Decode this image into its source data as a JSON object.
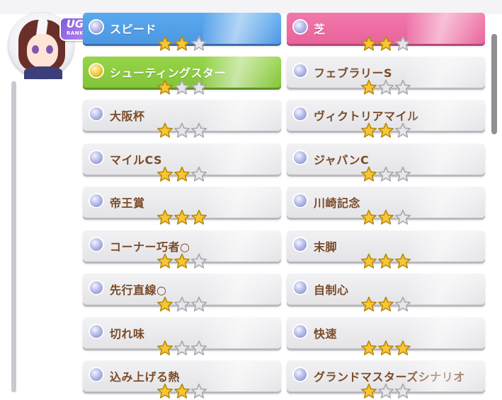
{
  "profile": {
    "rank_letters": "UG",
    "rank_word": "RANK"
  },
  "colors": {
    "star_filled": "#f7c632",
    "star_empty": "#e6e6ea",
    "label_text": "#7a4b28",
    "speed_card": "#4c97e3",
    "turf_card": "#e9639b",
    "unique_skill_card": "#82c537"
  },
  "skills": [
    {
      "label": "スピード",
      "stars": 2,
      "kind": "blue",
      "gem": "normal-gem-icon"
    },
    {
      "label": "芝",
      "stars": 2,
      "kind": "pink",
      "gem": "normal-gem-icon"
    },
    {
      "label": "シューティングスター",
      "stars": 1,
      "kind": "green",
      "gem": "gold-gem-icon"
    },
    {
      "label": "フェブラリーS",
      "stars": 1,
      "kind": "white",
      "gem": "normal-gem-icon"
    },
    {
      "label": "大阪杯",
      "stars": 1,
      "kind": "white",
      "gem": "normal-gem-icon"
    },
    {
      "label": "ヴィクトリアマイル",
      "stars": 2,
      "kind": "white",
      "gem": "normal-gem-icon"
    },
    {
      "label": "マイルCS",
      "stars": 2,
      "kind": "white",
      "gem": "normal-gem-icon"
    },
    {
      "label": "ジャパンC",
      "stars": 1,
      "kind": "white",
      "gem": "normal-gem-icon"
    },
    {
      "label": "帝王賞",
      "stars": 3,
      "kind": "white",
      "gem": "normal-gem-icon"
    },
    {
      "label": "川崎記念",
      "stars": 2,
      "kind": "white",
      "gem": "normal-gem-icon"
    },
    {
      "label": "コーナー巧者○",
      "stars": 2,
      "kind": "white",
      "gem": "normal-gem-icon"
    },
    {
      "label": "末脚",
      "stars": 3,
      "kind": "white",
      "gem": "normal-gem-icon"
    },
    {
      "label": "先行直線○",
      "stars": 1,
      "kind": "white",
      "gem": "normal-gem-icon"
    },
    {
      "label": "自制心",
      "stars": 2,
      "kind": "white",
      "gem": "normal-gem-icon"
    },
    {
      "label": "切れ味",
      "stars": 1,
      "kind": "white",
      "gem": "normal-gem-icon"
    },
    {
      "label": "快速",
      "stars": 3,
      "kind": "white",
      "gem": "normal-gem-icon"
    },
    {
      "label": "込み上げる熱",
      "stars": 2,
      "kind": "white",
      "gem": "normal-gem-icon"
    },
    {
      "label": "グランドマスターズシナリオ",
      "stars": 1,
      "kind": "white",
      "gem": "normal-gem-icon"
    }
  ]
}
